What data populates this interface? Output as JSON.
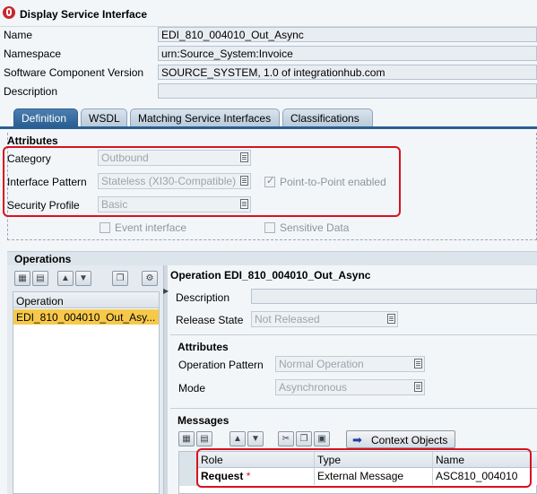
{
  "window": {
    "title": "Display Service Interface"
  },
  "header": {
    "name_label": "Name",
    "name_value": "EDI_810_004010_Out_Async",
    "namespace_label": "Namespace",
    "namespace_value": "urn:Source_System:Invoice",
    "swcv_label": "Software Component Version",
    "swcv_value": "SOURCE_SYSTEM, 1.0 of integrationhub.com",
    "description_label": "Description",
    "description_value": ""
  },
  "tabs": [
    {
      "label": "Definition",
      "active": true
    },
    {
      "label": "WSDL",
      "active": false
    },
    {
      "label": "Matching Service Interfaces",
      "active": false
    },
    {
      "label": "Classifications",
      "active": false
    }
  ],
  "attributes": {
    "title": "Attributes",
    "category_label": "Category",
    "category_value": "Outbound",
    "pattern_label": "Interface Pattern",
    "pattern_value": "Stateless (XI30-Compatible)",
    "p2p_label": "Point-to-Point enabled",
    "security_label": "Security Profile",
    "security_value": "Basic",
    "event_label": "Event interface",
    "sensitive_label": "Sensitive Data"
  },
  "operations": {
    "title": "Operations",
    "column_header": "Operation",
    "items": [
      "EDI_810_004010_Out_Asy..."
    ]
  },
  "operation_detail": {
    "title": "Operation EDI_810_004010_Out_Async",
    "description_label": "Description",
    "release_label": "Release State",
    "release_value": "Not Released",
    "attributes_title": "Attributes",
    "op_pattern_label": "Operation Pattern",
    "op_pattern_value": "Normal Operation",
    "mode_label": "Mode",
    "mode_value": "Asynchronous"
  },
  "messages": {
    "title": "Messages",
    "context_button": "Context Objects",
    "columns": [
      "Role",
      "Type",
      "Name"
    ],
    "rows": [
      {
        "role": "Request",
        "required": "*",
        "type": "External Message",
        "name": "ASC810_004010"
      }
    ]
  },
  "colors": {
    "highlight": "#d7121f",
    "tab_active": "#2a5f93",
    "selected_row": "#f7c94b"
  }
}
